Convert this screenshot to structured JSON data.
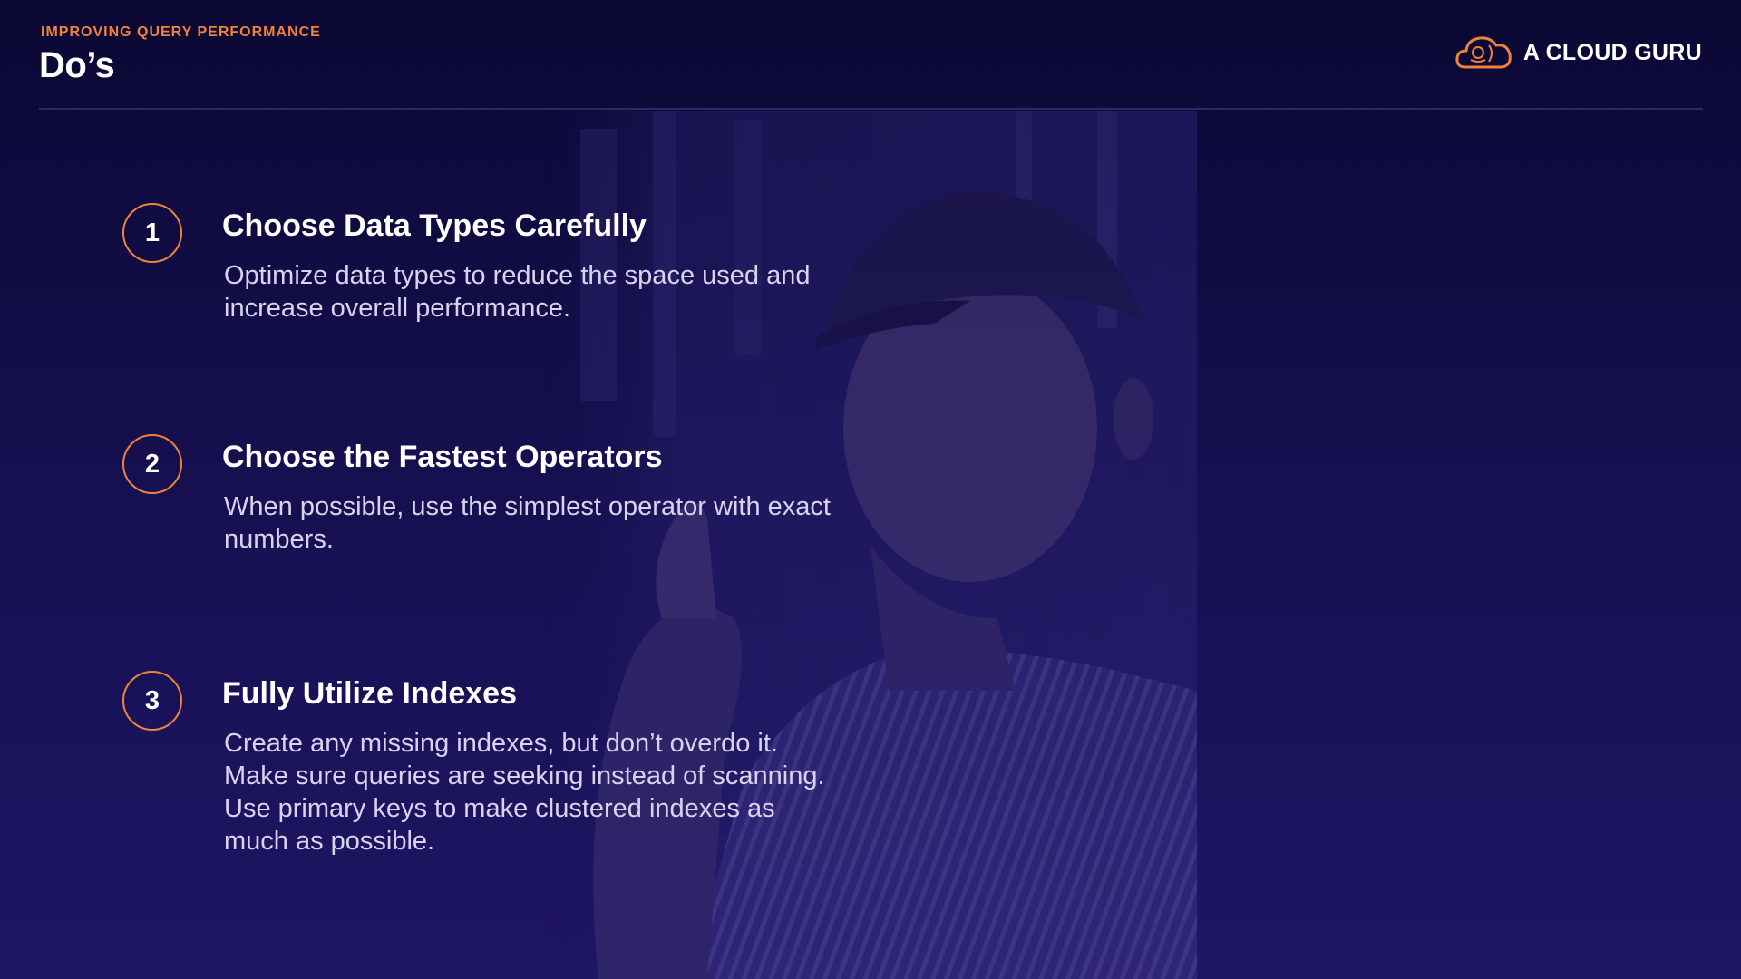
{
  "header": {
    "eyebrow": "IMPROVING QUERY PERFORMANCE",
    "title": "Do’s"
  },
  "brand": {
    "name": "A CLOUD GURU",
    "icon": "cloud-logo-icon",
    "accent_color": "#f0833a"
  },
  "items": [
    {
      "number": "1",
      "title": "Choose Data Types Carefully",
      "description": "Optimize data types to reduce the space used and increase overall performance."
    },
    {
      "number": "2",
      "title": "Choose the Fastest Operators",
      "description": "When possible, use the simplest operator with exact numbers."
    },
    {
      "number": "3",
      "title": "Fully Utilize Indexes",
      "description": "Create any missing indexes, but don’t overdo it. Make sure queries are seeking instead of scanning. Use primary keys to make clustered indexes as much as possible."
    }
  ],
  "colors": {
    "background_top": "#0b0834",
    "background_bottom": "#1f1665",
    "accent": "#f0833a",
    "description_text": "#d8d3ef"
  }
}
